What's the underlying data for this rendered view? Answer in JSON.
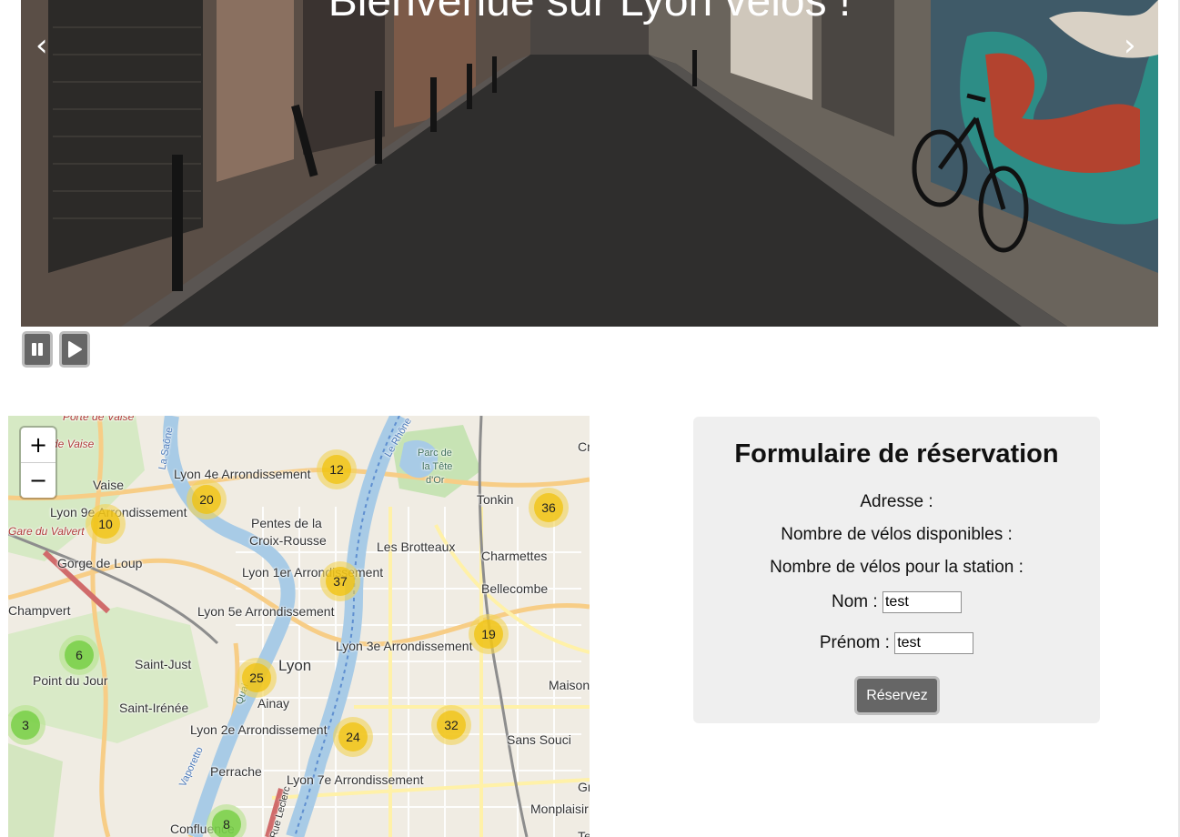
{
  "slider": {
    "title": "Bienvenue sur Lyon vélos !",
    "prev_arrow": "‹",
    "next_arrow": "›",
    "pause_icon": "pause-icon",
    "play_icon": "play-icon"
  },
  "map": {
    "zoom_in": "+",
    "zoom_out": "−",
    "labels": [
      {
        "text": "Porte de Vaise"
      },
      {
        "text": "Gare de Vaise"
      },
      {
        "text": "Vaise"
      },
      {
        "text": "Lyon 9e Arrondissement"
      },
      {
        "text": "Gare du Valvert"
      },
      {
        "text": "Gorge de Loup"
      },
      {
        "text": "Champvert"
      },
      {
        "text": "Lyon 4e Arrondissement"
      },
      {
        "text": "Pentes de la"
      },
      {
        "text": "Croix-Rousse"
      },
      {
        "text": "Lyon 1er Arrondissement"
      },
      {
        "text": "Lyon 5e Arrondissement"
      },
      {
        "text": "Saint-Just"
      },
      {
        "text": "Point du Jour"
      },
      {
        "text": "Saint-Irénée"
      },
      {
        "text": "Lyon"
      },
      {
        "text": "Ainay"
      },
      {
        "text": "Lyon 2e Arrondissement"
      },
      {
        "text": "Perrache"
      },
      {
        "text": "Confluence"
      },
      {
        "text": "Lyon 7e Arrondissement"
      },
      {
        "text": "Lyon 3e Arrondissement"
      },
      {
        "text": "Les Brotteaux"
      },
      {
        "text": "Charmettes"
      },
      {
        "text": "Bellecombe"
      },
      {
        "text": "Tonkin"
      },
      {
        "text": "Parc de"
      },
      {
        "text": "la Tête"
      },
      {
        "text": "d'Or"
      },
      {
        "text": "Maison"
      },
      {
        "text": "Sans Souci"
      },
      {
        "text": "Monplaisir"
      },
      {
        "text": "Cr"
      },
      {
        "text": "Gr"
      },
      {
        "text": "Te"
      },
      {
        "text": "Quai"
      },
      {
        "text": "Le Rhône"
      },
      {
        "text": "La Saône"
      },
      {
        "text": "Vaporetto"
      },
      {
        "text": "Rue Leclerc"
      }
    ],
    "clusters": [
      {
        "count": "12",
        "color": "yellow"
      },
      {
        "count": "20",
        "color": "yellow"
      },
      {
        "count": "10",
        "color": "yellow"
      },
      {
        "count": "36",
        "color": "yellow"
      },
      {
        "count": "37",
        "color": "yellow"
      },
      {
        "count": "19",
        "color": "yellow"
      },
      {
        "count": "6",
        "color": "green"
      },
      {
        "count": "25",
        "color": "yellow"
      },
      {
        "count": "3",
        "color": "green"
      },
      {
        "count": "24",
        "color": "yellow"
      },
      {
        "count": "32",
        "color": "yellow"
      },
      {
        "count": "8",
        "color": "green"
      }
    ]
  },
  "form": {
    "title": "Formulaire de réservation",
    "address_label": "Adresse :",
    "bikes_available_label": "Nombre de vélos disponibles :",
    "bikes_station_label": "Nombre de vélos pour la station :",
    "nom_label": "Nom :",
    "nom_value": "test",
    "prenom_label": "Prénom :",
    "prenom_value": "test",
    "submit_label": "Réservez"
  },
  "colors": {
    "button_bg": "#666666",
    "form_bg": "#efefef",
    "cluster_yellow": "#f0c20c",
    "cluster_green": "#6ecc39"
  }
}
